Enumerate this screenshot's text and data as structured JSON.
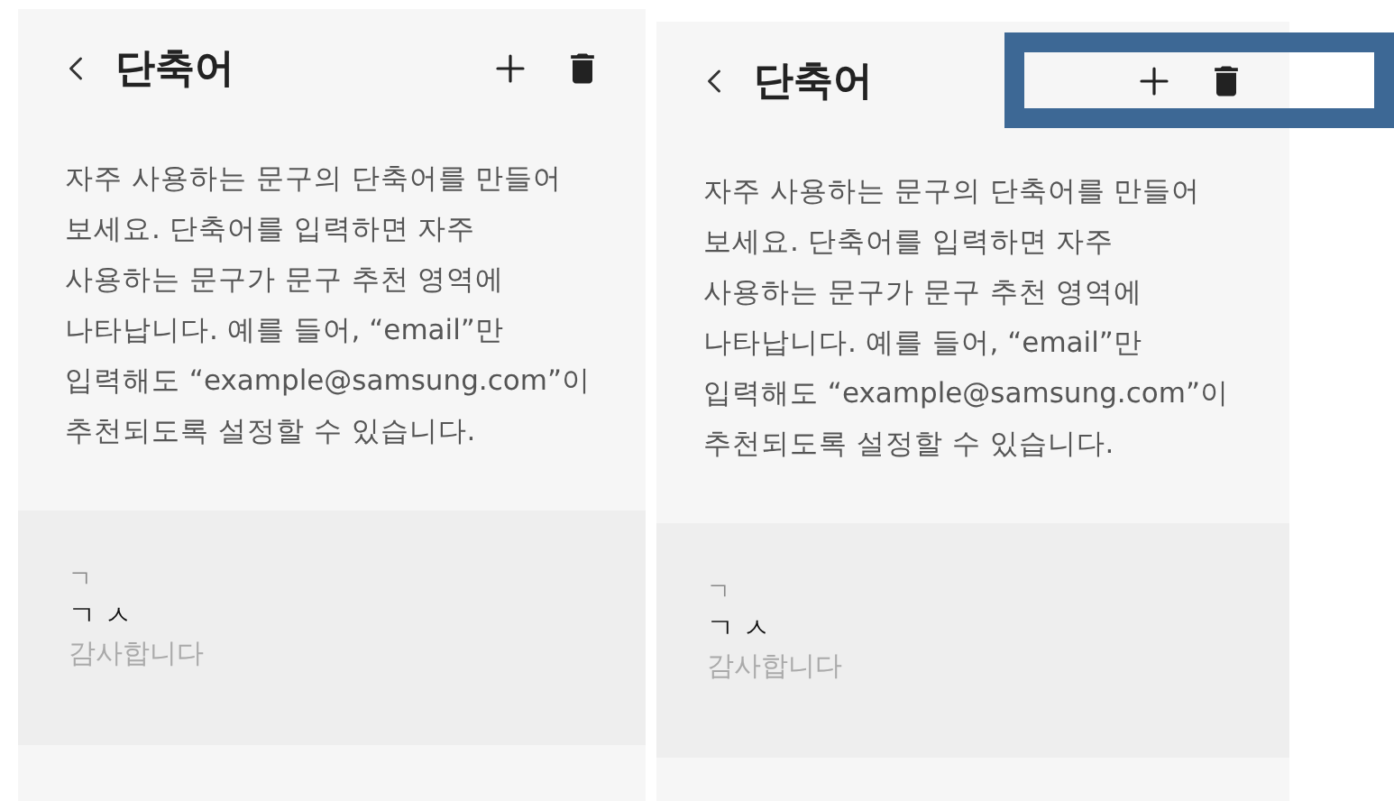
{
  "panels": [
    {
      "title": "단축어",
      "description": "자주 사용하는 문구의 단축어를 만들어\n보세요. 단축어를 입력하면 자주\n사용하는 문구가 문구 추천 영역에\n나타납니다. 예를 들어, “email”만\n입력해도 “example@samsung.com”이\n추천되도록 설정할 수 있습니다.",
      "index_letter": "ㄱ",
      "shortcuts": [
        {
          "shortcut": "ㄱ ㅅ",
          "phrase": "감사합니다"
        }
      ]
    },
    {
      "title": "단축어",
      "description": "자주 사용하는 문구의 단축어를 만들어\n보세요. 단축어를 입력하면 자주\n사용하는 문구가 문구 추천 영역에\n나타납니다. 예를 들어, “email”만\n입력해도 “example@samsung.com”이\n추천되도록 설정할 수 있습니다.",
      "index_letter": "ㄱ",
      "shortcuts": [
        {
          "shortcut": "ㄱ ㅅ",
          "phrase": "감사합니다"
        }
      ],
      "highlighted": true
    }
  ]
}
